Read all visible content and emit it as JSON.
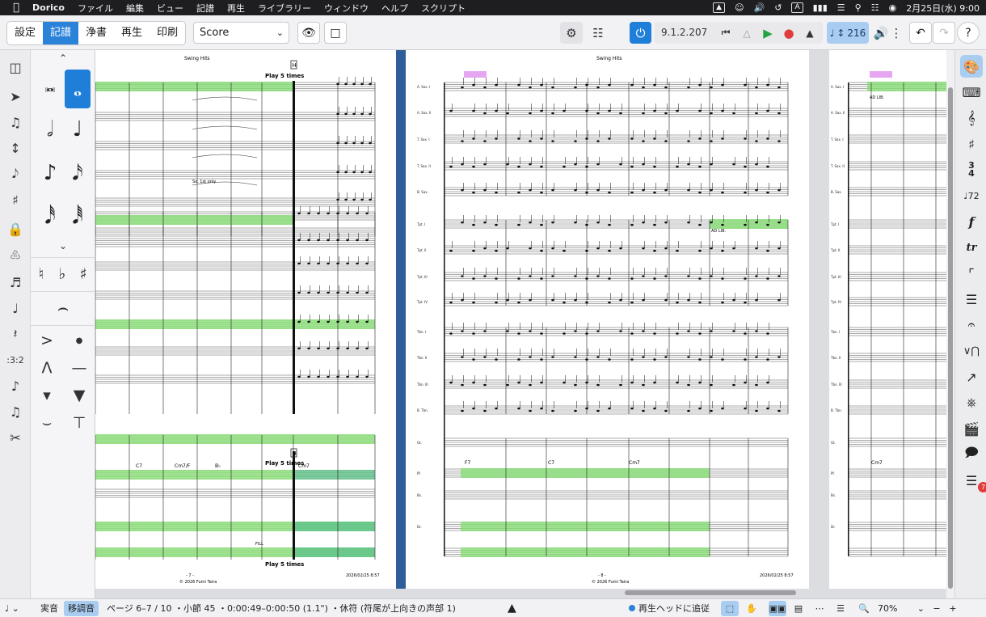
{
  "menubar": {
    "app_name": "Dorico",
    "menus": [
      "ファイル",
      "編集",
      "ビュー",
      "記譜",
      "再生",
      "ライブラリー",
      "ウィンドウ",
      "ヘルプ",
      "スクリプト"
    ],
    "status_a": "A",
    "datetime": "2月25日(水) 9:00"
  },
  "toolbar": {
    "modes": [
      "設定",
      "記譜",
      "浄書",
      "再生",
      "印刷"
    ],
    "active_mode": "記譜",
    "layout": "Score",
    "position": "9.1.2.207",
    "tempo": "216"
  },
  "left_panel": {
    "tuplet_label": ":3:2"
  },
  "score": {
    "pages": [
      {
        "header": "Swing Hits",
        "rehearsal": "H",
        "play_text_top": "Play 5 times",
        "play_text_mid": "Play 5 times",
        "play_text_bottom": "Play 5 times",
        "chords": [
          "C7",
          "Cm7/F",
          "B♭",
          "Cm7"
        ],
        "page_number": "- 7 -",
        "copyright": "© 2026 Fumi Taira",
        "date": "2026/02/25 8:57",
        "text_solo": "Sx. 1st only",
        "text_fill": "FILL"
      },
      {
        "header": "Swing Hits",
        "rehearsal": "",
        "page_number": "- 8 -",
        "copyright": "© 2026 Fumi Taira",
        "date": "2026/02/25 8:57",
        "ad_lib": "AD LIB.",
        "chords": [
          "F7",
          "C7",
          "Cm7"
        ]
      },
      {
        "ad_lib": "AD LIB.",
        "chords": [
          "Cm7"
        ]
      }
    ],
    "staff_names": [
      "A. Sax. I",
      "A. Sax. II",
      "T. Sax. I",
      "T. Sax. II",
      "B. Sax.",
      "Tpt. I",
      "Tpt. II",
      "Tpt. III",
      "Tpt. IV",
      "Tbn. I",
      "Tbn. II",
      "Tbn. III",
      "B. Tbn.",
      "Gt.",
      "Pf.",
      "Bs.",
      "Dr."
    ]
  },
  "right_panel": {
    "tempo_mark": "♩72",
    "notifications": "7"
  },
  "statusbar": {
    "concert": "実音",
    "transposed": "移調音",
    "info": "ページ 6–7 / 10 ・小節 45 ・0:00:49–0:00:50 (1.1\") ・休符 (符尾が上向きの声部 1)",
    "follow": "再生ヘッドに追従",
    "zoom": "70%"
  }
}
